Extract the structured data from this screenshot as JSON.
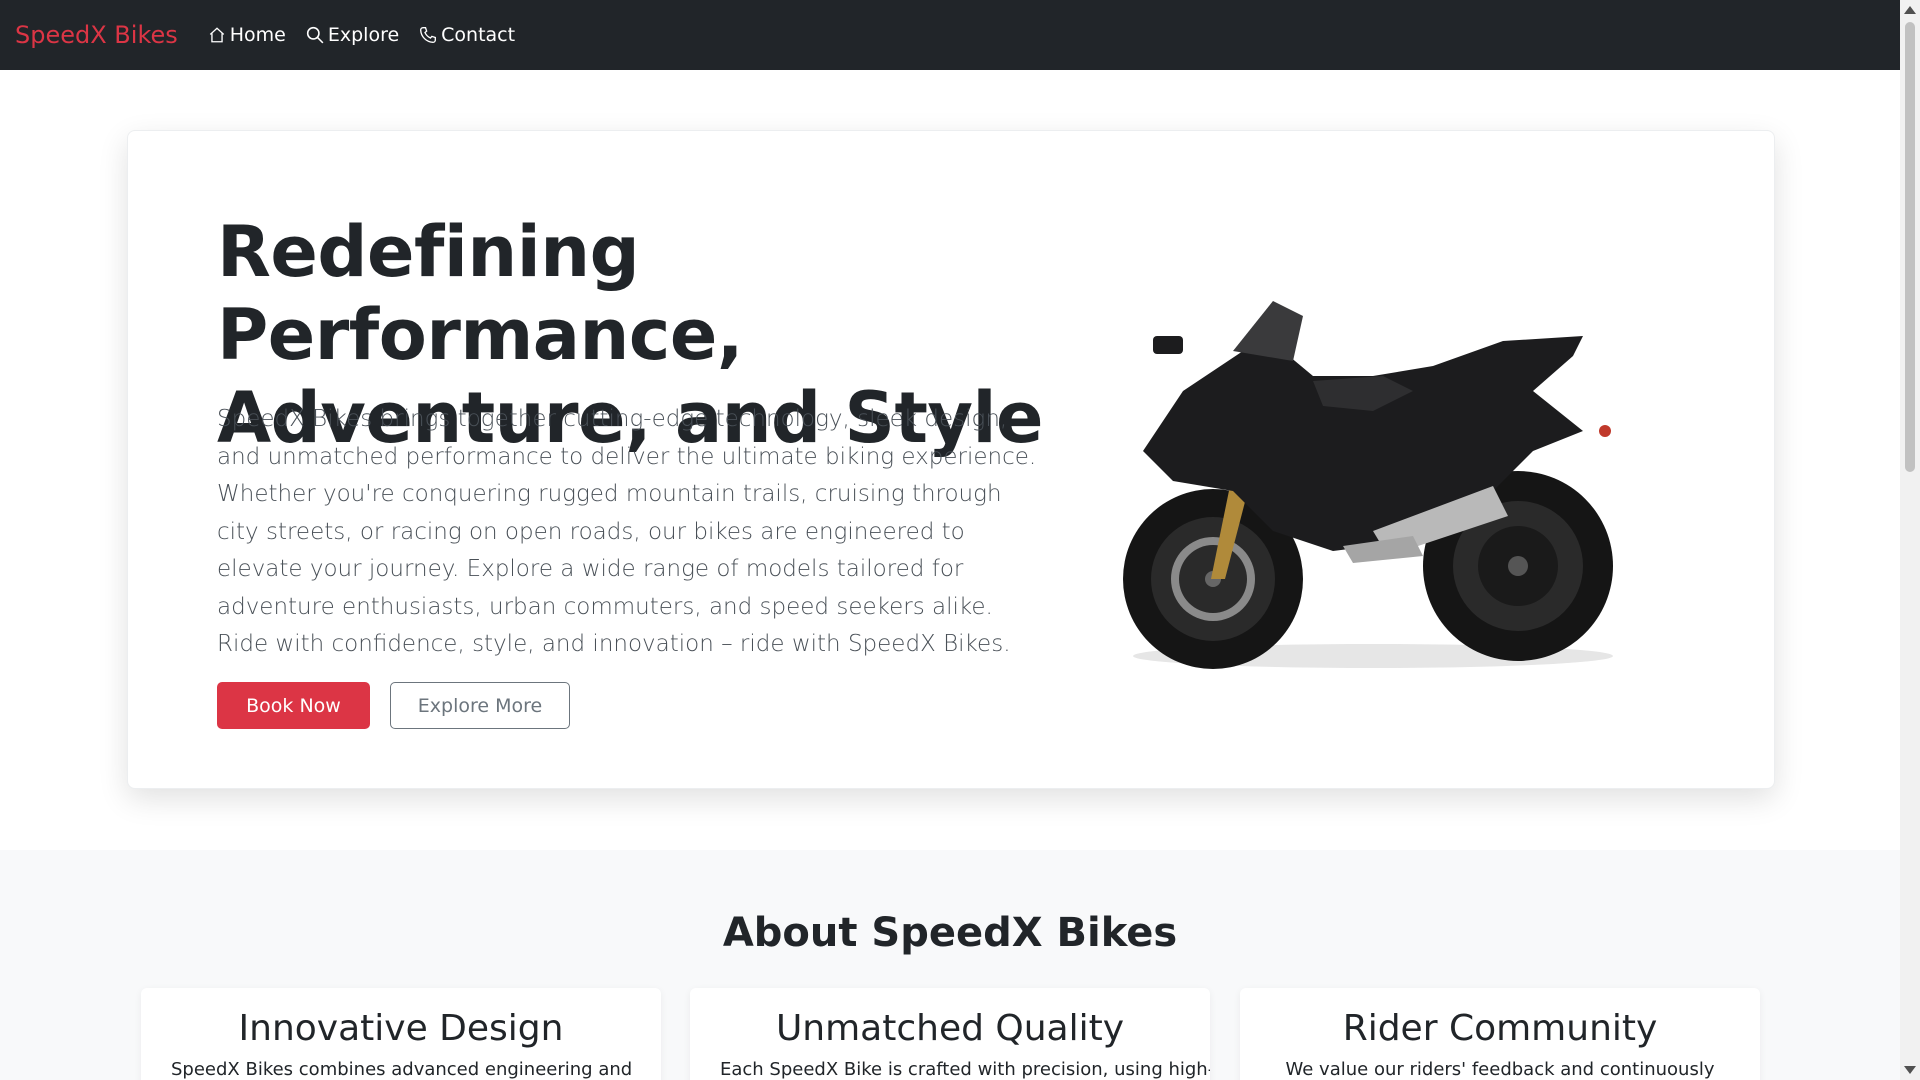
{
  "nav": {
    "brand": "SpeedX Bikes",
    "items": [
      {
        "label": "Home",
        "icon": "home-icon"
      },
      {
        "label": "Explore",
        "icon": "search-icon"
      },
      {
        "label": "Contact",
        "icon": "phone-icon"
      }
    ]
  },
  "hero": {
    "title_line1": "Redefining Performance,",
    "title_line2": "Adventure, and Style",
    "description": "SpeedX Bikes brings together cutting-edge technology, sleek design, and unmatched performance to deliver the ultimate biking experience. Whether you're conquering rugged mountain trails, cruising through city streets, or racing on open roads, our bikes are engineered to elevate your journey. Explore a wide range of models tailored for adventure enthusiasts, urban commuters, and speed seekers alike. Ride with confidence, style, and innovation – ride with SpeedX Bikes.",
    "primary_button": "Book Now",
    "secondary_button": "Explore More"
  },
  "about": {
    "title": "About SpeedX Bikes",
    "features": [
      {
        "title": "Innovative Design",
        "text": "SpeedX Bikes combines advanced engineering and"
      },
      {
        "title": "Unmatched Quality",
        "text": "Each SpeedX Bike is crafted with precision, using high-"
      },
      {
        "title": "Rider Community",
        "text": "We value our riders' feedback and continuously"
      }
    ]
  },
  "colors": {
    "brand": "#dc3545",
    "navbar": "#212529",
    "section_bg": "#f8f9fa"
  }
}
